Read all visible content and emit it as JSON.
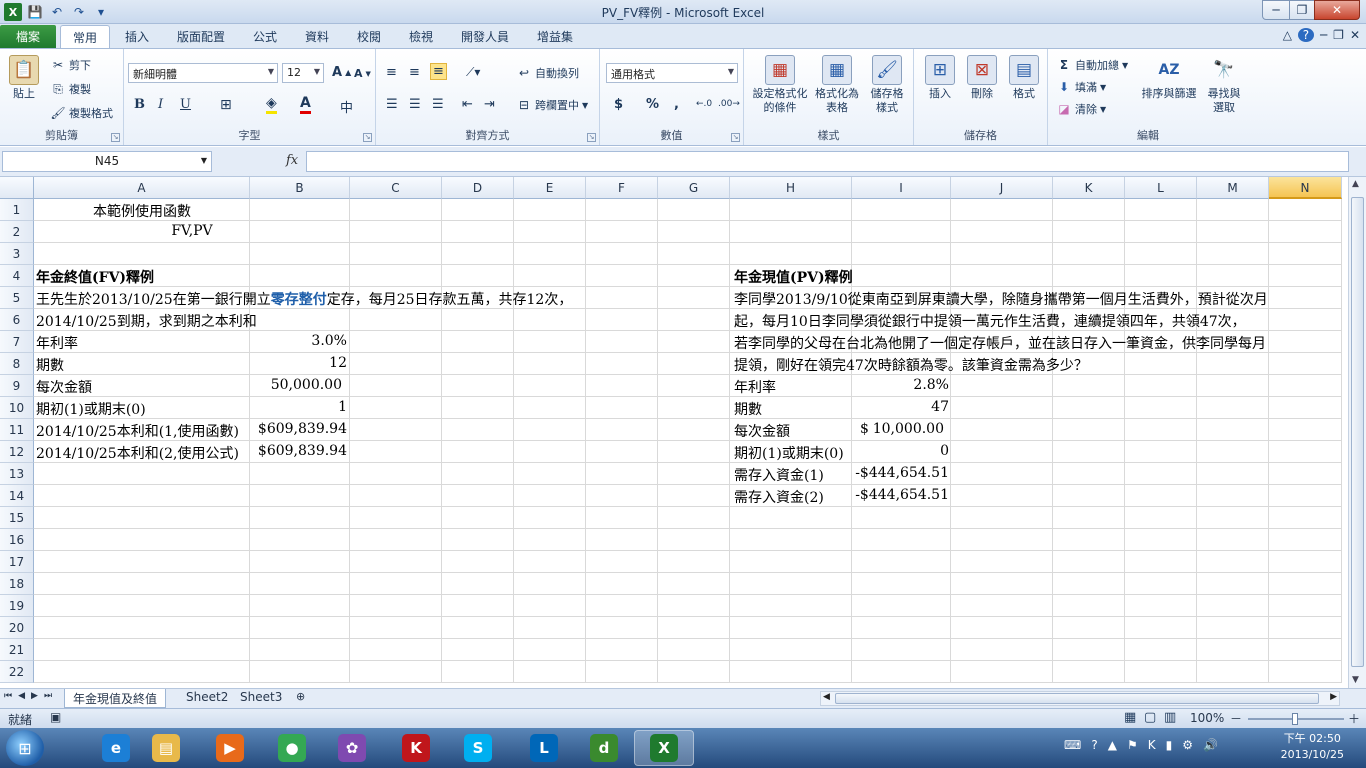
{
  "window": {
    "title": "PV_FV釋例  -  Microsoft Excel",
    "min": "─",
    "max": "❐",
    "close": "✕"
  },
  "qat": [
    "💾",
    "↶",
    "↷",
    "▾"
  ],
  "tabs": {
    "file": "檔案",
    "items": [
      "常用",
      "插入",
      "版面配置",
      "公式",
      "資料",
      "校閱",
      "檢視",
      "開發人員",
      "增益集"
    ],
    "active": "常用",
    "right": [
      "△",
      "?",
      "─",
      "❐",
      "✕"
    ]
  },
  "ribbon": {
    "clipboard": {
      "label": "剪貼簿",
      "paste": "貼上",
      "cut": "剪下",
      "copy": "複製",
      "format_painter": "複製格式"
    },
    "font": {
      "label": "字型",
      "name": "新細明體",
      "size": "12",
      "bold": "B",
      "italic": "I",
      "underline": "U"
    },
    "alignment": {
      "label": "對齊方式",
      "wrap": "自動換列",
      "merge": "跨欄置中"
    },
    "number": {
      "label": "數值",
      "format": "通用格式",
      "currency": "$",
      "percent": "%",
      "comma": ","
    },
    "styles": {
      "label": "樣式",
      "cond1": "設定格式化",
      "cond2": "的條件",
      "table1": "格式化為",
      "table2": "表格",
      "cell1": "儲存格",
      "cell2": "樣式"
    },
    "cells": {
      "label": "儲存格",
      "insert": "插入",
      "delete": "刪除",
      "format": "格式"
    },
    "editing": {
      "label": "編輯",
      "autosum": "自動加總",
      "fill": "填滿",
      "clear": "清除",
      "sort1": "排序與篩選",
      "find1": "尋找與",
      "find2": "選取"
    }
  },
  "formula_bar": {
    "name_box": "N45",
    "fx": "fx",
    "value": ""
  },
  "columns": [
    "A",
    "B",
    "C",
    "D",
    "E",
    "F",
    "G",
    "H",
    "I",
    "J",
    "K",
    "L",
    "M",
    "N"
  ],
  "selected_column": "N",
  "rows": [
    "1",
    "2",
    "3",
    "4",
    "5",
    "6",
    "7",
    "8",
    "9",
    "10",
    "11",
    "12",
    "13",
    "14",
    "15",
    "16",
    "17",
    "18",
    "19",
    "20",
    "21",
    "22"
  ],
  "cells": {
    "A1": "本範例使用函數",
    "A2": "FV,PV",
    "A4": "年金終值(FV)釋例",
    "A5_pre": "王先生於2013/10/25在第一銀行開立",
    "A5_hl": "零存整付",
    "A5_post": "定存，每月25日存款五萬，共存12次，",
    "A6": "2014/10/25到期，求到期之本利和",
    "A7": "年利率",
    "B7": "3.0%",
    "A8": "期數",
    "B8": "12",
    "A9": "每次金額",
    "B9": "50,000.00",
    "A10": "期初(1)或期末(0)",
    "B10": "1",
    "A11": "2014/10/25本利和(1,使用函數)",
    "B11": "$609,839.94",
    "A12": "2014/10/25本利和(2,使用公式)",
    "B12": "$609,839.94",
    "H4": "年金現值(PV)釋例",
    "H5": "李同學2013/9/10從東南亞到屏東讀大學，除隨身攜帶第一個月生活費外，預計從次月",
    "H6": "起，每月10日李同學須從銀行中提領一萬元作生活費，連續提領四年，共領47次，",
    "H7": "若李同學的父母在台北為他開了一個定存帳戶，並在該日存入一筆資金，供李同學每月",
    "H8": "提領，剛好在領完47次時餘額為零。該筆資金需為多少？",
    "H9": "年利率",
    "I9": "2.8%",
    "H10": "期數",
    "I10": "47",
    "H11": "每次金額",
    "I11_cur": "$",
    "I11": "10,000.00",
    "H12": "期初(1)或期末(0)",
    "I12": "0",
    "H13": "需存入資金(1)",
    "I13": "-$444,654.51",
    "H14": "需存入資金(2)",
    "I14": "-$444,654.51"
  },
  "sheets": [
    "年金現值及終值",
    "Sheet2",
    "Sheet3"
  ],
  "sheet_nav": [
    "⏮",
    "◀",
    "▶",
    "⏭"
  ],
  "status": {
    "mode": "就緒",
    "zoom": "100%",
    "minus": "－",
    "plus": "＋"
  },
  "taskbar": {
    "start": "⊞",
    "apps": [
      {
        "name": "ie-icon",
        "glyph": "e",
        "color": "#1c7fd6"
      },
      {
        "name": "explorer-icon",
        "glyph": "▤",
        "color": "#e8b94a"
      },
      {
        "name": "media-player-icon",
        "glyph": "▶",
        "color": "#e86a1a"
      },
      {
        "name": "chrome-icon",
        "glyph": "●",
        "color": "#34a853"
      },
      {
        "name": "picasa-icon",
        "glyph": "✿",
        "color": "#7f4ab0"
      },
      {
        "name": "kaspersky-icon",
        "glyph": "K",
        "color": "#c0161b"
      },
      {
        "name": "skype-icon",
        "glyph": "S",
        "color": "#00aff0"
      },
      {
        "name": "lync-icon",
        "glyph": "L",
        "color": "#0067b8"
      },
      {
        "name": "dreamweaver-icon",
        "glyph": "d",
        "color": "#3a8a2e"
      },
      {
        "name": "excel-icon",
        "glyph": "X",
        "color": "#1f7a2e"
      }
    ],
    "time": "下午 02:50",
    "date": "2013/10/25"
  }
}
